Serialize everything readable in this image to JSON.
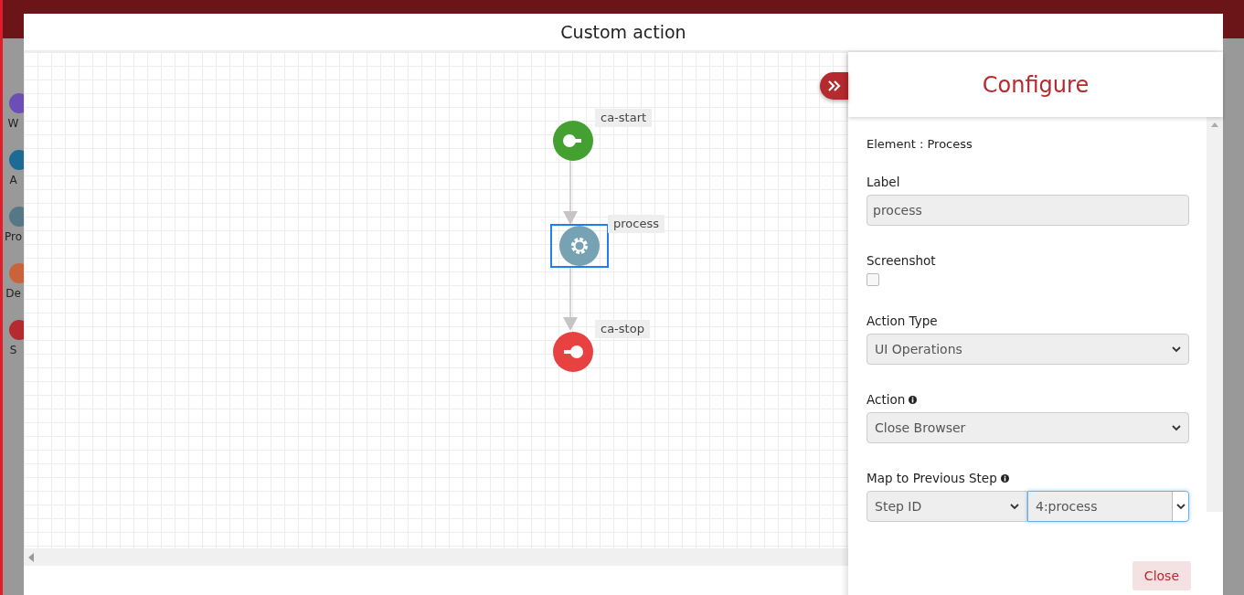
{
  "app": {
    "sidebar_items": [
      {
        "label": "W",
        "color": "#6b4fb5"
      },
      {
        "label": "A",
        "color": "#1d6a94"
      },
      {
        "label": "Pro",
        "color": "#557786"
      },
      {
        "label": "De",
        "color": "#c9643a"
      },
      {
        "label": "S",
        "color": "#b52a2f"
      }
    ]
  },
  "modal": {
    "title": "Custom action",
    "nodes": [
      {
        "label": "ca-start",
        "kind": "start",
        "selected": false
      },
      {
        "label": "process",
        "kind": "process",
        "selected": true
      },
      {
        "label": "ca-stop",
        "kind": "stop",
        "selected": false
      }
    ],
    "panel": {
      "title": "Configure",
      "element": "Element : Process",
      "fields": [
        {
          "kind": "text",
          "label": "Label",
          "value": "process"
        },
        {
          "kind": "checkbox",
          "label": "Screenshot",
          "checked": false
        },
        {
          "kind": "select",
          "label": "Action Type",
          "value": "UI Operations",
          "info": false
        },
        {
          "kind": "select",
          "label": "Action",
          "value": "Close Browser",
          "info": true
        },
        {
          "kind": "select-pair",
          "label": "Map to Previous Step",
          "info": true,
          "values": [
            "Step ID",
            "4:process"
          ]
        }
      ]
    },
    "close_button": "Close"
  }
}
